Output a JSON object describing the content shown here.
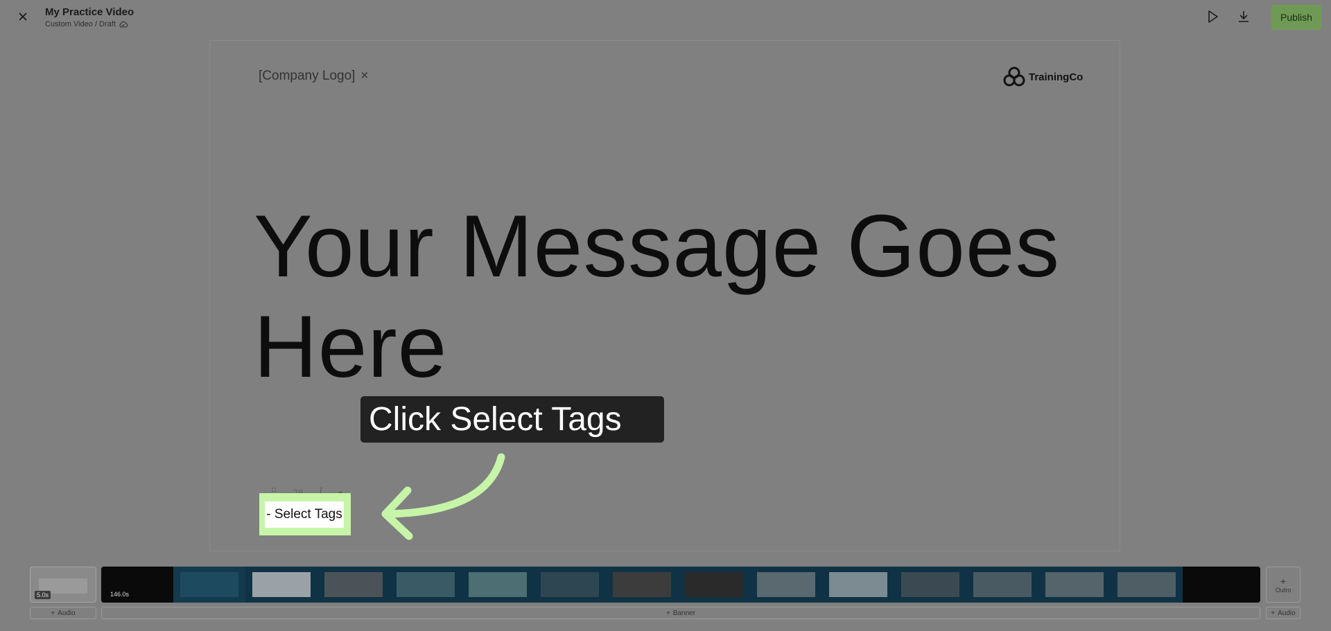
{
  "header": {
    "title": "My Practice Video",
    "subtitle": "Custom Video / Draft",
    "publish_label": "Publish"
  },
  "canvas": {
    "company_logo": "[Company Logo]",
    "company_logo_remove": "×",
    "brand_name": "TrainingCo",
    "headline": "Your Message Goes Here",
    "toolbar_font_size": "28"
  },
  "guide": {
    "tooltip": "Click Select Tags",
    "highlight_color": "#c7f5a8"
  },
  "select_tags_button": "- Select Tags",
  "timeline": {
    "intro_duration": "5.0s",
    "main_duration": "146.0s",
    "outro_label": "Outro",
    "add_audio_left": "Audio",
    "add_banner": "Banner",
    "add_audio_right": "Audio"
  },
  "colors": {
    "overlay": "#808080",
    "publish": "#6f9a56",
    "strip": "#0f3344"
  }
}
